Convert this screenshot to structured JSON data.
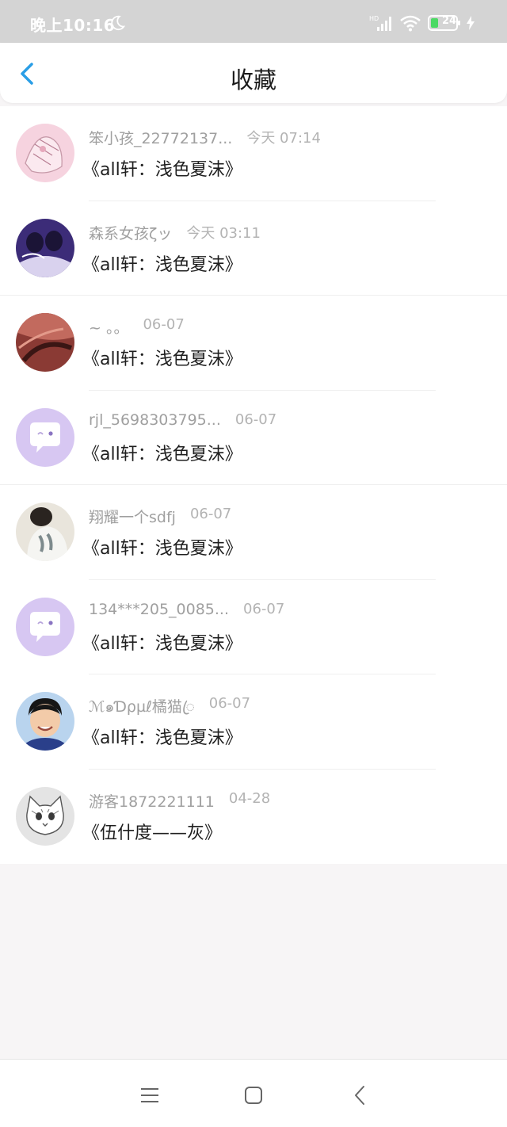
{
  "status_bar": {
    "time": "晚上10:16",
    "battery": "24",
    "icons": [
      "moon-icon",
      "hd-signal-icon",
      "wifi-icon",
      "battery-icon",
      "charging-icon"
    ]
  },
  "header": {
    "title": "收藏",
    "back_icon": "chevron-left-icon"
  },
  "favorites": [
    {
      "user": "笨小孩_22772137...",
      "time": "今天 07:14",
      "title": "《all轩：浅色夏沫》",
      "avatar": "pink-sketch"
    },
    {
      "user": "森系女孩ζッ",
      "time": "今天 03:11",
      "title": "《all轩：浅色夏沫》",
      "avatar": "purple-photo"
    },
    {
      "user": "~ 。。",
      "time": "06-07",
      "title": "《all轩：浅色夏沫》",
      "avatar": "red-photo"
    },
    {
      "user": "rjl_5698303795...",
      "time": "06-07",
      "title": "《all轩：浅色夏沫》",
      "avatar": "default-chat"
    },
    {
      "user": "翔耀一个sdfj",
      "time": "06-07",
      "title": "《all轩：浅色夏沫》",
      "avatar": "person-photo"
    },
    {
      "user": "134***205_0085...",
      "time": "06-07",
      "title": "《all轩：浅色夏沫》",
      "avatar": "default-chat"
    },
    {
      "user": "ℳ๑Ɗρµℓ橘猫ꦿ",
      "time": "06-07",
      "title": "《all轩：浅色夏沫》",
      "avatar": "boy-photo"
    },
    {
      "user": "游客1872221111",
      "time": "04-28",
      "title": "《伍什度——灰》",
      "avatar": "cat-sketch"
    }
  ],
  "system_nav": {
    "icons": [
      "menu-icon",
      "home-square-icon",
      "back-arrow-icon"
    ]
  },
  "colors": {
    "accent": "#2a9ee6",
    "default_avatar": "#d7c7f2",
    "status_bar": "#d4d4d4"
  }
}
